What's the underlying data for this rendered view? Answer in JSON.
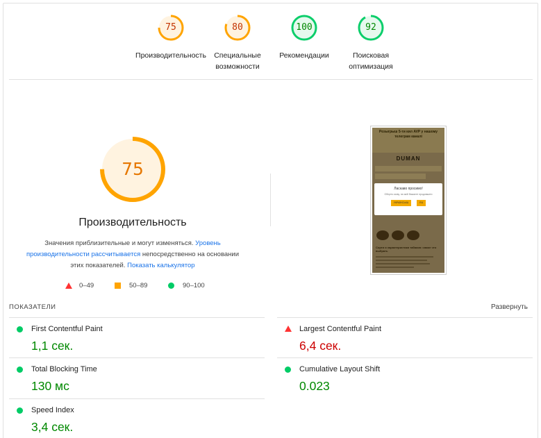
{
  "gauges": [
    {
      "score": "75",
      "label_line1": "Производительность",
      "label_line2": "",
      "color": "#ffa400",
      "fill": "#fff3e0",
      "text_color": "#c33300",
      "pct": 75
    },
    {
      "score": "80",
      "label_line1": "Специальные",
      "label_line2": "возможности",
      "color": "#ffa400",
      "fill": "#fff3e0",
      "text_color": "#c33300",
      "pct": 80
    },
    {
      "score": "100",
      "label_line1": "Рекомендации",
      "label_line2": "",
      "color": "#0cce6b",
      "fill": "#e6f9ee",
      "text_color": "#008800",
      "pct": 100
    },
    {
      "score": "92",
      "label_line1": "Поисковая",
      "label_line2": "оптимизация",
      "color": "#0cce6b",
      "fill": "#e6f9ee",
      "text_color": "#008800",
      "pct": 92
    }
  ],
  "performance": {
    "score": "75",
    "title": "Производительность",
    "desc_part1": "Значения приблизительные и могут изменяться.",
    "desc_link1": "Уровень производительности рассчитывается",
    "desc_part2": "непосредственно на основании этих показателей.",
    "desc_link2": "Показать калькулятор"
  },
  "legend": {
    "fail": "0–49",
    "average": "50–89",
    "pass": "90–100"
  },
  "screenshot": {
    "banner": "Розыгрыш 5-ти кил AVP у нашому телеграм каналі",
    "logo": "DUMAN",
    "modal_title": "Ласкаво просимо!",
    "modal_subtitle": "Оберіть мову, на якій бажаєте продовжити",
    "btn_ua": "УКРАЇНСЬКА",
    "btn_ru": "RU",
    "text": "Сорти и характеристики табаков: самое что выбрать"
  },
  "metrics": {
    "header": "ПОКАЗАТЕЛИ",
    "expand": "Развернуть",
    "items": [
      {
        "name": "First Contentful Paint",
        "value": "1,1 сек.",
        "status": "pass"
      },
      {
        "name": "Largest Contentful Paint",
        "value": "6,4 сек.",
        "status": "fail"
      },
      {
        "name": "Total Blocking Time",
        "value": "130 мс",
        "status": "pass"
      },
      {
        "name": "Cumulative Layout Shift",
        "value": "0.023",
        "status": "pass"
      },
      {
        "name": "Speed Index",
        "value": "3,4 сек.",
        "status": "pass"
      }
    ]
  }
}
